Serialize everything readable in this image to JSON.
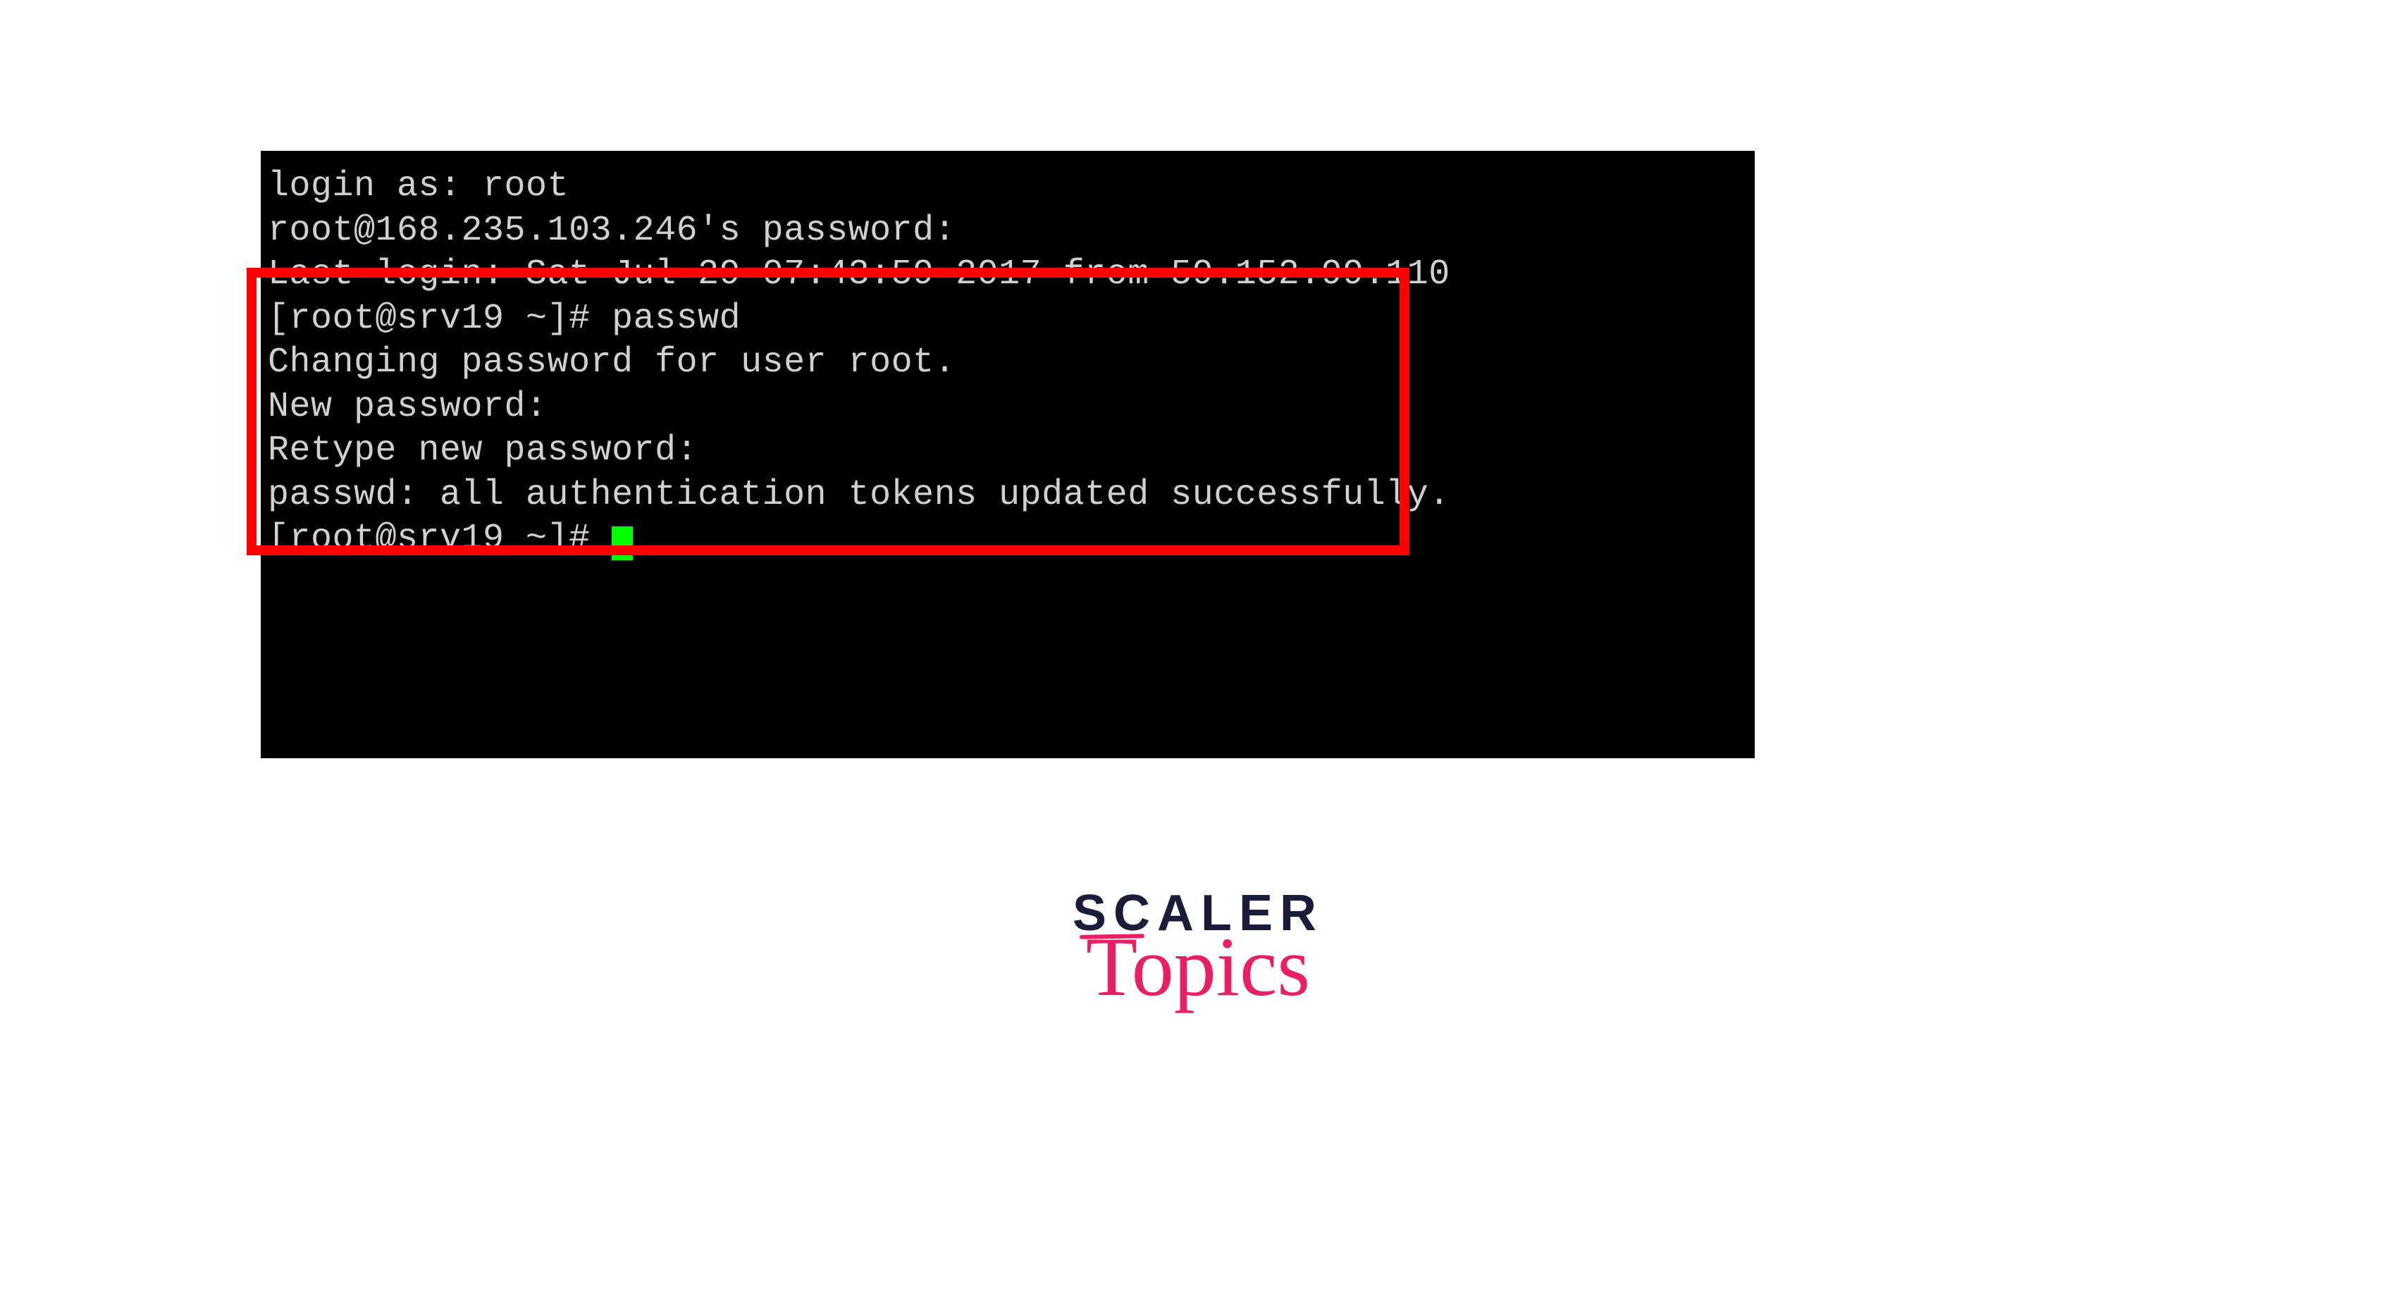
{
  "terminal": {
    "lines": [
      "login as: root",
      "root@168.235.103.246's password:",
      "Last login: Sat Jul 29 07:43:59 2017 from 59.152.99.110",
      "[root@srv19 ~]# passwd",
      "Changing password for user root.",
      "New password:",
      "Retype new password:",
      "passwd: all authentication tokens updated successfully.",
      "[root@srv19 ~]# "
    ]
  },
  "logo": {
    "line1": "SCALER",
    "line2": "Topics"
  },
  "colors": {
    "highlightBorder": "#ff0000",
    "cursor": "#00ff00",
    "terminalBg": "#000000",
    "terminalText": "#d0d0d0",
    "logoDark": "#1a1d3a",
    "logoPink": "#e91e63"
  }
}
